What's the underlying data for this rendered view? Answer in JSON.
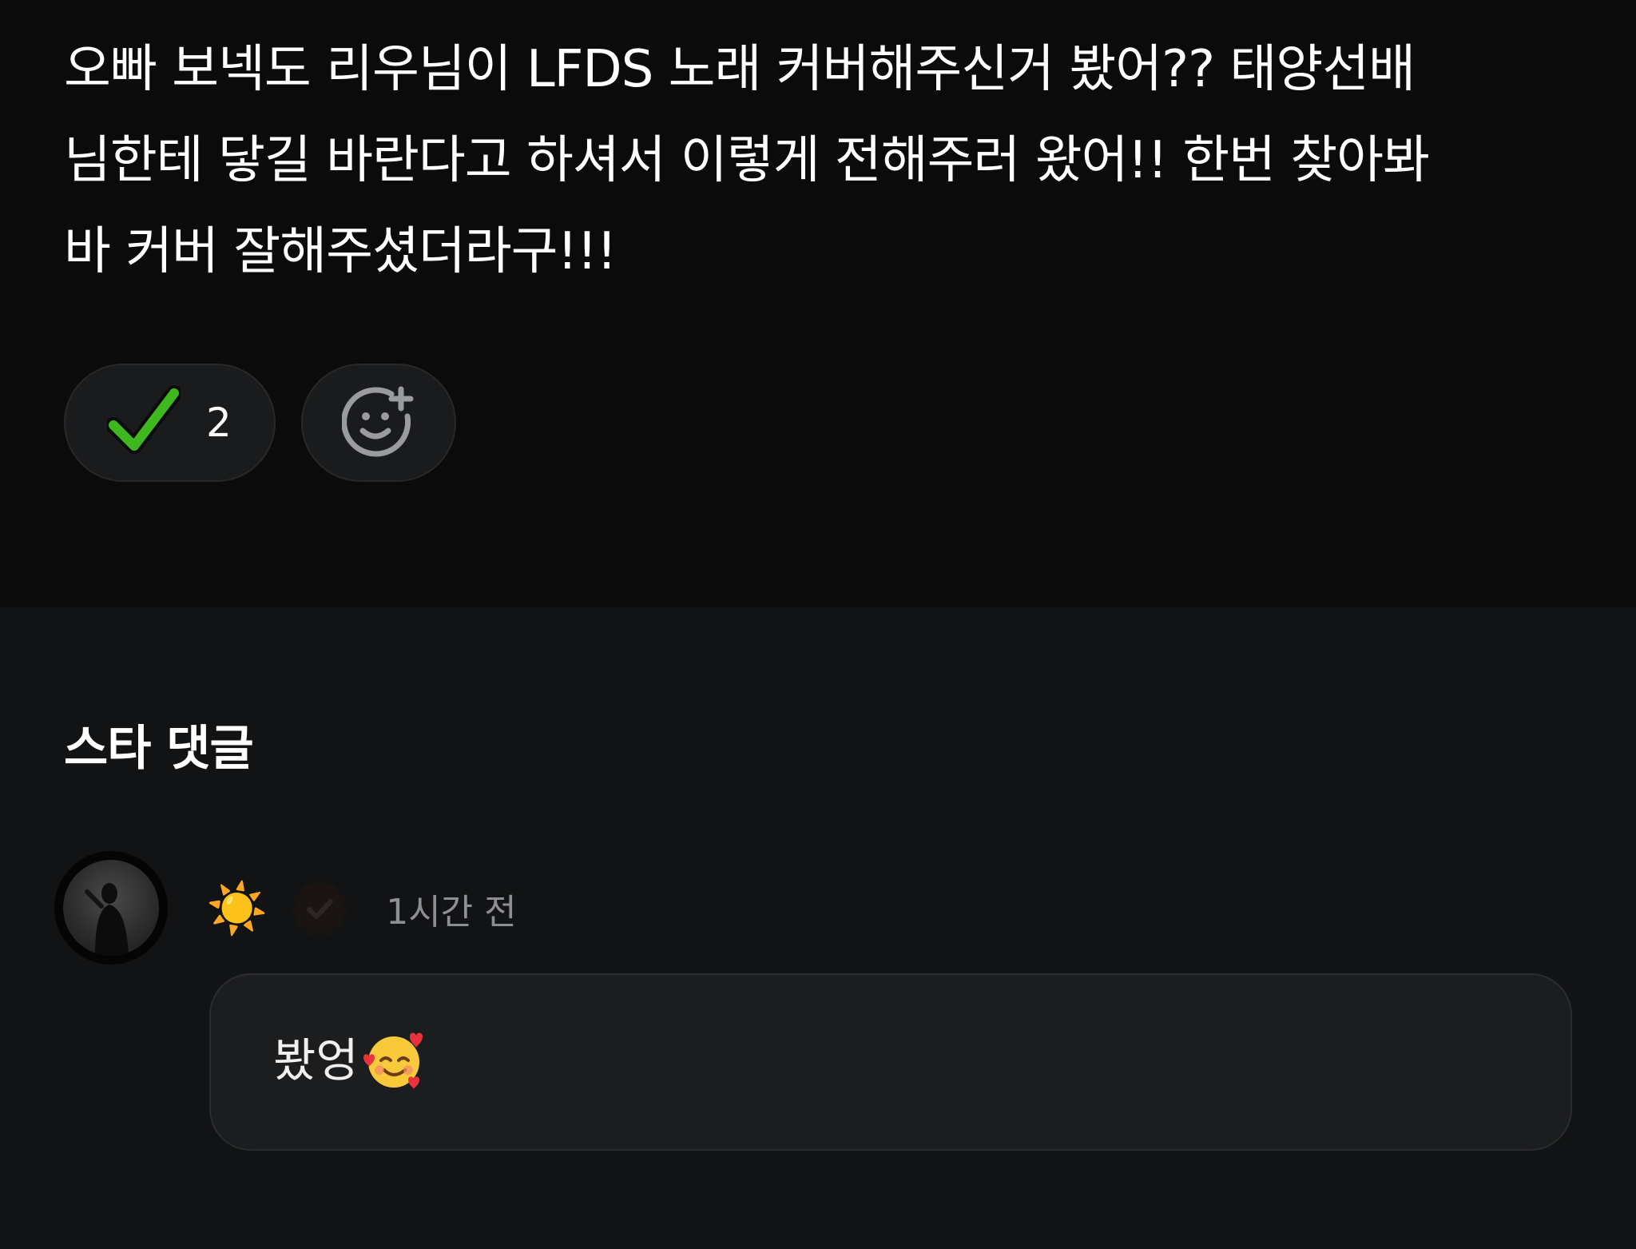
{
  "post": {
    "text": "오빠 보넥도 리우님이 LFDS 노래 커버해주신거 봤어?? 태양선배\n님한테 닿길 바란다고 하셔서 이렇게 전해주러 왔어!! 한번 찾아봐\n바 커버 잘해주셨더라구!!!"
  },
  "reactions": {
    "check": {
      "icon": "check-mark-icon",
      "count": "2"
    },
    "add": {
      "icon": "add-reaction-icon"
    }
  },
  "comments_section": {
    "title": "스타 댓글",
    "comments": [
      {
        "avatar_icon": "avatar",
        "nickname": "☀️",
        "verified_icon": "verified-badge-icon",
        "timestamp": "1시간 전",
        "text": "봤엉",
        "emoji_icon": "smiling-face-with-hearts-icon"
      }
    ]
  },
  "colors": {
    "background": "#0b0b0b",
    "comments_background": "#121314",
    "pill_background": "#1a1b1c",
    "check_green": "#3fb81f",
    "muted_text": "#8e8f92"
  }
}
